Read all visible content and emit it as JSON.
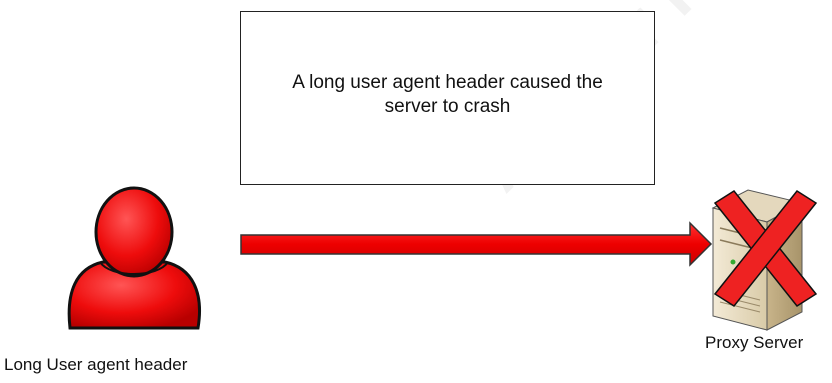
{
  "callout": {
    "text": "A long user agent header caused the server to crash"
  },
  "user": {
    "label": "Long User agent header",
    "icon": "user-icon",
    "color": "#ee1111"
  },
  "arrow": {
    "color": "#ee0000"
  },
  "server": {
    "label": "Proxy Server",
    "icon": "server-icon",
    "status_icon": "red-x-icon",
    "status_color": "#ee2222"
  },
  "watermark": {
    "text": "Author retains"
  }
}
